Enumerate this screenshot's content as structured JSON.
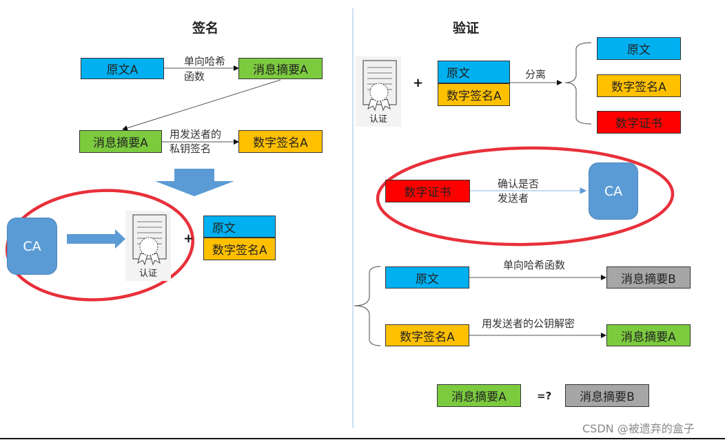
{
  "sign": {
    "title": "签名",
    "original": "原文A",
    "hash_label_line1": "单向哈希",
    "hash_label_line2": "函数",
    "digest_top": "消息摘要A",
    "digest_left": "消息摘要A",
    "sign_label_line1": "用发送者的",
    "sign_label_line2": "私钥签名",
    "signature": "数字签名A",
    "ca": "CA",
    "cert_caption": "认证",
    "plus": "+",
    "bundle_top": "原文",
    "bundle_bottom": "数字签名A"
  },
  "verify": {
    "title": "验证",
    "cert_caption": "认证",
    "plus": "+",
    "bundle_top": "原文",
    "bundle_bottom": "数字签名A",
    "split_label": "分离",
    "split_items": [
      "原文",
      "数字签名A",
      "数字证书"
    ],
    "cert_box": "数字证书",
    "confirm_label_line1": "确认是否",
    "confirm_label_line2": "发送者",
    "ca": "CA",
    "row1_source": "原文",
    "row1_label": "单向哈希函数",
    "row1_result": "消息摘要B",
    "row2_source": "数字签名A",
    "row2_label": "用发送者的公钥解密",
    "row2_result": "消息摘要A",
    "compare_left": "消息摘要A",
    "compare_op": "=?",
    "compare_right": "消息摘要B"
  },
  "colors": {
    "blue": "#00b0f0",
    "green": "#7ccb3f",
    "orange": "#ffc000",
    "red": "#ff0000",
    "gray": "#a6a6a6",
    "ca_blue": "#5b9bd5",
    "highlight_ring": "#e8303a"
  },
  "watermark": "CSDN @被遗弃的盒子"
}
